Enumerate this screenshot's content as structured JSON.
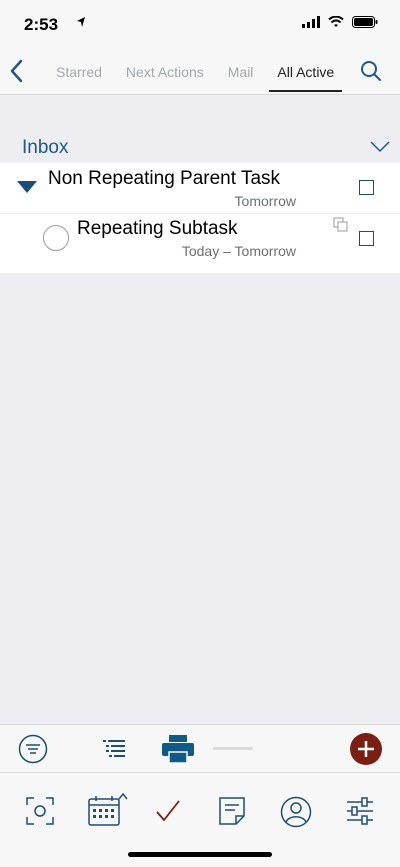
{
  "status": {
    "time": "2:53"
  },
  "nav": {
    "tabs": [
      "Starred",
      "Next Actions",
      "Mail",
      "All Active"
    ],
    "active_tab": "All Active"
  },
  "section": {
    "title": "Inbox"
  },
  "tasks": [
    {
      "title": "Non Repeating Parent Task",
      "date": "Tomorrow"
    },
    {
      "title": "Repeating Subtask",
      "date": "Today – Tomorrow"
    }
  ],
  "colors": {
    "accent": "#1b5a86",
    "add_button": "#7a1f12"
  },
  "icons": {
    "toolbar": [
      "filter-icon",
      "list-icon",
      "print-icon",
      "add-icon"
    ],
    "tabbar": [
      "focus-icon",
      "calendar-icon",
      "checkmark-icon",
      "notes-icon",
      "contact-icon",
      "settings-sliders-icon"
    ]
  }
}
